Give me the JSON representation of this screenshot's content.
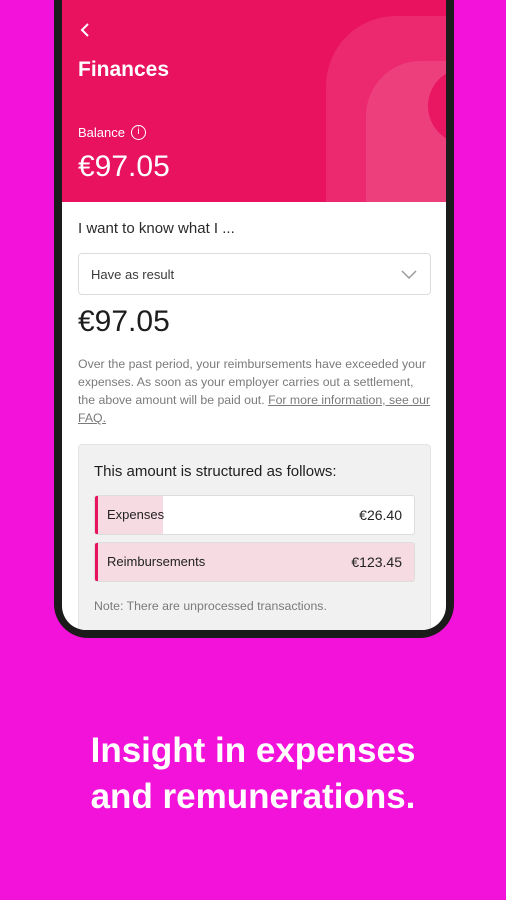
{
  "header": {
    "title": "Finances",
    "balance_label": "Balance",
    "balance_value": "€97.05"
  },
  "query": {
    "question": "I want to know what I ...",
    "selected_option": "Have as result"
  },
  "result": {
    "amount": "€97.05",
    "description": "Over the past period, your reimbursements have exceeded your expenses. As soon as your employer carries out a settlement, the above amount will be paid out.",
    "faq_link": "For more information, see our FAQ."
  },
  "structure": {
    "title": "This amount is structured as follows:",
    "rows": [
      {
        "label": "Expenses",
        "value": "€26.40",
        "fill_fraction": 0.214
      },
      {
        "label": "Reimbursements",
        "value": "€123.45",
        "fill_fraction": 1.0
      }
    ],
    "note": "Note: There are unprocessed transactions."
  },
  "tagline": {
    "line1": "Insight in expenses",
    "line2": "and remunerations."
  },
  "colors": {
    "background": "#f212d9",
    "header": "#e8125f",
    "bar_fill": "#f6dbe3"
  },
  "icons": [
    "back-arrow-icon",
    "info-icon",
    "chevron-down-icon"
  ]
}
